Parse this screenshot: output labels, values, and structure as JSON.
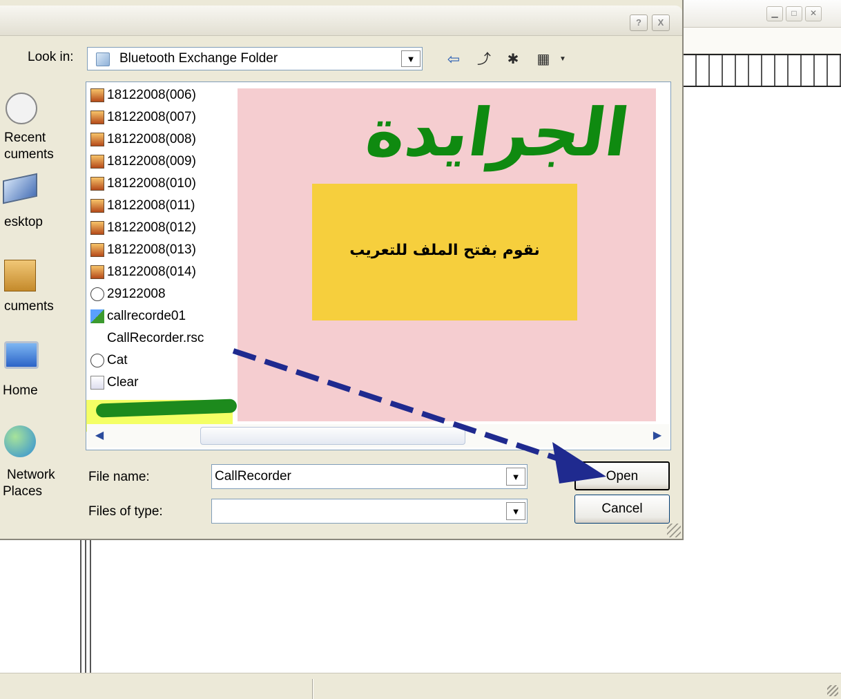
{
  "dialog": {
    "look_in_label": "Look in:",
    "look_in_value": "Bluetooth Exchange Folder",
    "help_button": "?",
    "close_button": "X"
  },
  "places": [
    {
      "line1": "Recent",
      "line2": "cuments",
      "icon": "recent-documents-icon"
    },
    {
      "line1": "esktop",
      "line2": "",
      "icon": "desktop-icon"
    },
    {
      "line1": "cuments",
      "line2": "",
      "icon": "my-documents-icon"
    },
    {
      "line1": "Home",
      "line2": "",
      "icon": "my-computer-icon"
    },
    {
      "line1": "Network",
      "line2": "Places",
      "icon": "network-places-icon"
    }
  ],
  "files": [
    {
      "name": "18122008(006)",
      "type": "archive"
    },
    {
      "name": "18122008(007)",
      "type": "archive"
    },
    {
      "name": "18122008(008)",
      "type": "archive"
    },
    {
      "name": "18122008(009)",
      "type": "archive"
    },
    {
      "name": "18122008(010)",
      "type": "archive"
    },
    {
      "name": "18122008(011)",
      "type": "archive"
    },
    {
      "name": "18122008(012)",
      "type": "archive"
    },
    {
      "name": "18122008(013)",
      "type": "archive"
    },
    {
      "name": "18122008(014)",
      "type": "archive"
    },
    {
      "name": "29122008",
      "type": "disc"
    },
    {
      "name": "callrecorde01",
      "type": "app"
    },
    {
      "name": "CallRecorder.rsc",
      "type": "blank"
    },
    {
      "name": "Cat",
      "type": "disc"
    },
    {
      "name": "Clear",
      "type": "doc"
    }
  ],
  "overlay": {
    "title": "الجرايدة",
    "text": "نقوم بفتح الملف للتعريب"
  },
  "fields": {
    "file_name_label": "File name:",
    "file_name_value": "CallRecorder",
    "files_of_type_label": "Files of type:",
    "files_of_type_value": ""
  },
  "buttons": {
    "open": "Open",
    "cancel": "Cancel"
  },
  "colors": {
    "highlight": "#f2ff4a",
    "overlay_bg": "#f5cdd0",
    "overlay_box": "#f6cf3d",
    "overlay_title": "#0f8a10",
    "arrow": "#1f2a8f"
  }
}
